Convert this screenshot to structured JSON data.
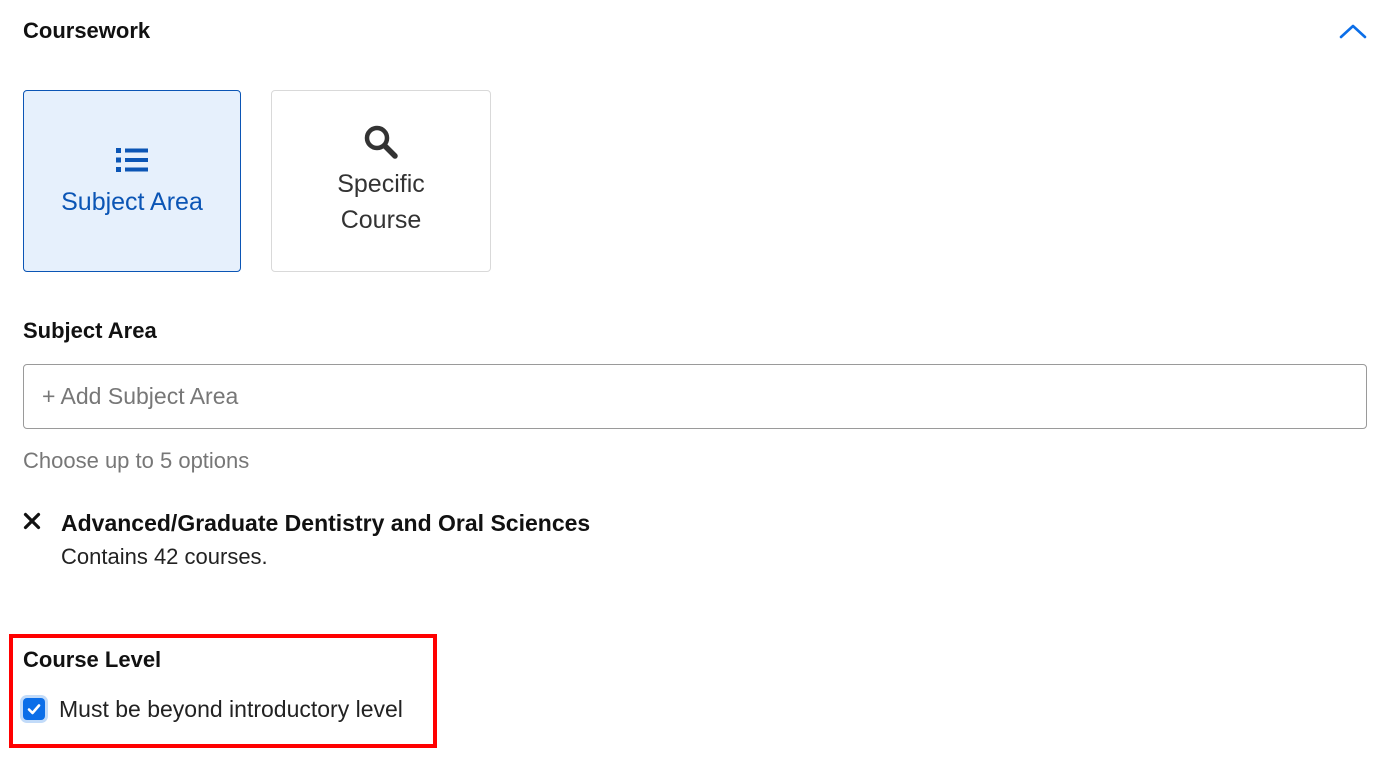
{
  "section": {
    "title": "Coursework",
    "collapse_icon": "chevron-up-icon"
  },
  "search_type": {
    "options": [
      {
        "label": "Subject Area",
        "icon": "list-icon",
        "selected": true
      },
      {
        "label": "Specific Course",
        "icon": "search-icon",
        "selected": false
      }
    ]
  },
  "subject_area": {
    "label": "Subject Area",
    "placeholder": "+ Add Subject Area",
    "value": "",
    "help": "Choose up to 5 options"
  },
  "selected_subjects": [
    {
      "title": "Advanced/Graduate Dentistry and Oral Sciences",
      "subtitle": "Contains 42 courses."
    }
  ],
  "course_level": {
    "label": "Course Level",
    "checkbox_label": "Must be beyond introductory level",
    "checked": true
  },
  "colors": {
    "accent": "#0b55b5",
    "selected_bg": "#e6f0fc",
    "checkbox": "#0b6ee8",
    "highlight": "#ff0000"
  }
}
